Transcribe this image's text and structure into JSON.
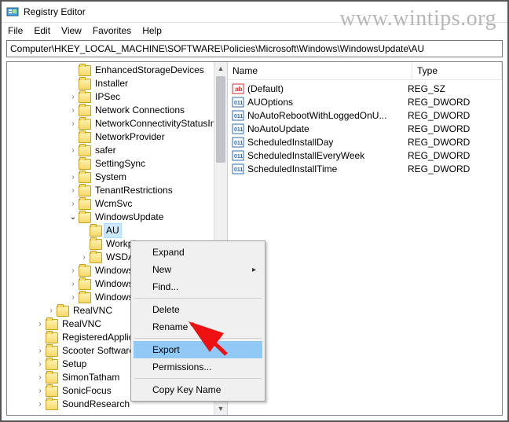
{
  "window": {
    "title": "Registry Editor"
  },
  "menu": {
    "file": "File",
    "edit": "Edit",
    "view": "View",
    "favorites": "Favorites",
    "help": "Help"
  },
  "address": "Computer\\HKEY_LOCAL_MACHINE\\SOFTWARE\\Policies\\Microsoft\\Windows\\WindowsUpdate\\AU",
  "tree": {
    "n0": "EnhancedStorageDevices",
    "n1": "Installer",
    "n2": "IPSec",
    "n3": "Network Connections",
    "n4": "NetworkConnectivityStatusIndicator",
    "n5": "NetworkProvider",
    "n6": "safer",
    "n7": "SettingSync",
    "n8": "System",
    "n9": "TenantRestrictions",
    "n10": "WcmSvc",
    "n11": "WindowsUpdate",
    "n12": "AU",
    "n13": "WorkplaceJoin",
    "n14": "WSDAPI",
    "n15": "WindowsFirewall",
    "n16": "WindowsUpdate",
    "n17": "WindowsUpdate",
    "n18": "RealVNC",
    "n19": "RealVNC",
    "n20": "RegisteredApplications",
    "n21": "Scooter Software",
    "n22": "Setup",
    "n23": "SimonTatham",
    "n24": "SonicFocus",
    "n25": "SoundResearch"
  },
  "list": {
    "colName": "Name",
    "colType": "Type",
    "r0": {
      "name": "(Default)",
      "type": "REG_SZ"
    },
    "r1": {
      "name": "AUOptions",
      "type": "REG_DWORD"
    },
    "r2": {
      "name": "NoAutoRebootWithLoggedOnU...",
      "type": "REG_DWORD"
    },
    "r3": {
      "name": "NoAutoUpdate",
      "type": "REG_DWORD"
    },
    "r4": {
      "name": "ScheduledInstallDay",
      "type": "REG_DWORD"
    },
    "r5": {
      "name": "ScheduledInstallEveryWeek",
      "type": "REG_DWORD"
    },
    "r6": {
      "name": "ScheduledInstallTime",
      "type": "REG_DWORD"
    }
  },
  "ctx": {
    "expand": "Expand",
    "new": "New",
    "find": "Find...",
    "delete": "Delete",
    "rename": "Rename",
    "export": "Export",
    "perms": "Permissions...",
    "copy": "Copy Key Name"
  },
  "watermark": "www.wintips.org"
}
